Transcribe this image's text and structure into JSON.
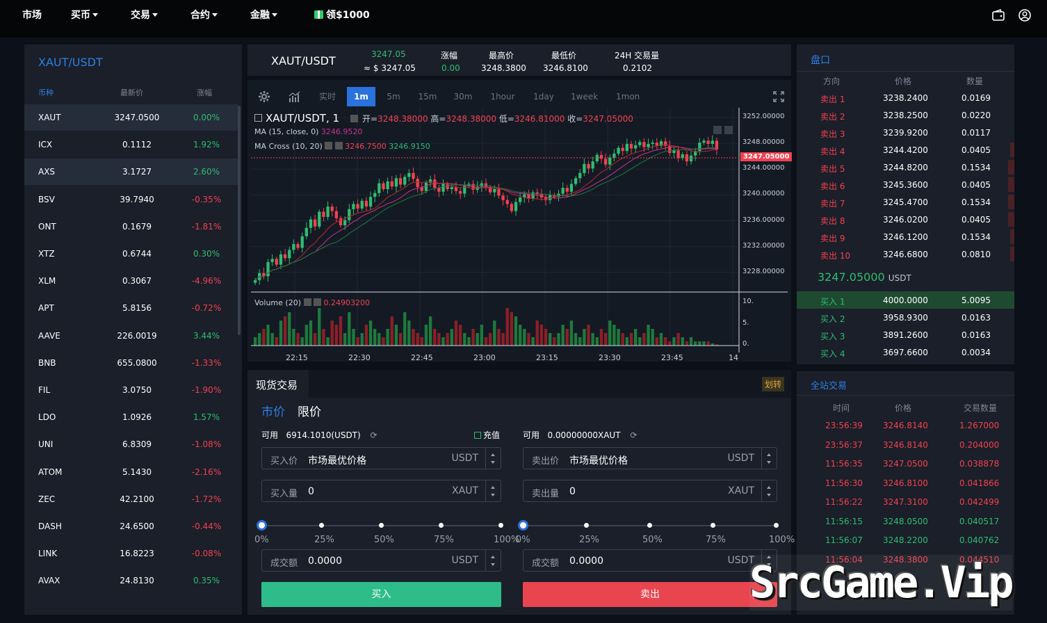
{
  "nav": {
    "market": "市场",
    "buy_coin": "买币",
    "trade": "交易",
    "contract": "合约",
    "finance": "金融",
    "promo": "领$1000",
    "wallet_icon": "wallet-icon",
    "user_icon": "user-icon"
  },
  "market_list": {
    "title": "XAUT/USDT",
    "col_coin": "币种",
    "col_price": "最新价",
    "col_change": "涨幅",
    "rows": [
      {
        "coin": "XAUT",
        "price": "3247.0500",
        "change": "0.00%",
        "dir": "up"
      },
      {
        "coin": "ICX",
        "price": "0.1112",
        "change": "1.92%",
        "dir": "up"
      },
      {
        "coin": "AXS",
        "price": "3.1727",
        "change": "2.60%",
        "dir": "up"
      },
      {
        "coin": "BSV",
        "price": "39.7940",
        "change": "-0.35%",
        "dir": "dn"
      },
      {
        "coin": "ONT",
        "price": "0.1679",
        "change": "-1.81%",
        "dir": "dn"
      },
      {
        "coin": "XTZ",
        "price": "0.6744",
        "change": "0.30%",
        "dir": "up"
      },
      {
        "coin": "XLM",
        "price": "0.3067",
        "change": "-4.96%",
        "dir": "dn"
      },
      {
        "coin": "APT",
        "price": "5.8156",
        "change": "-0.72%",
        "dir": "dn"
      },
      {
        "coin": "AAVE",
        "price": "226.0019",
        "change": "3.44%",
        "dir": "up"
      },
      {
        "coin": "BNB",
        "price": "655.0800",
        "change": "-1.33%",
        "dir": "dn"
      },
      {
        "coin": "FIL",
        "price": "3.0750",
        "change": "-1.90%",
        "dir": "dn"
      },
      {
        "coin": "LDO",
        "price": "1.0926",
        "change": "1.57%",
        "dir": "up"
      },
      {
        "coin": "UNI",
        "price": "6.8309",
        "change": "-1.08%",
        "dir": "dn"
      },
      {
        "coin": "ATOM",
        "price": "5.1430",
        "change": "-2.16%",
        "dir": "dn"
      },
      {
        "coin": "ZEC",
        "price": "42.2100",
        "change": "-1.72%",
        "dir": "dn"
      },
      {
        "coin": "DASH",
        "price": "24.6500",
        "change": "-0.44%",
        "dir": "dn"
      },
      {
        "coin": "LINK",
        "price": "16.8223",
        "change": "-0.08%",
        "dir": "dn"
      },
      {
        "coin": "AVAX",
        "price": "24.8130",
        "change": "0.35%",
        "dir": "up"
      }
    ]
  },
  "ticker": {
    "pair": "XAUT/USDT",
    "price": "3247.05",
    "price_usd": "≈ $ 3247.05",
    "change_label": "涨幅",
    "change": "0.00",
    "high_label": "最高价",
    "high": "3248.3800",
    "low_label": "最低价",
    "low": "3246.8100",
    "vol_label": "24H 交易量",
    "vol": "0.2102"
  },
  "chart_toolbar": {
    "settings_icon": "gear-icon",
    "indicator_icon": "chart-bars-icon",
    "realtime": "实时",
    "intervals": [
      "1m",
      "5m",
      "15m",
      "30m",
      "1hour",
      "1day",
      "1week",
      "1mon"
    ],
    "active": "1m",
    "fullscreen_icon": "expand-icon"
  },
  "chart_legend": {
    "symbol": "XAUT/USDT, 1",
    "open_label": "开=",
    "open": "3248.38000",
    "high_label": "高=",
    "high": "3248.38000",
    "low_label": "低=",
    "low": "3246.81000",
    "close_label": "收=",
    "close": "3247.05000",
    "ma": "MA (15, close, 0)",
    "ma_value": "3246.9520",
    "ma_cross": "MA Cross (10, 20)",
    "ma_cross_v1": "3246.7500",
    "ma_cross_v2": "3246.9150",
    "volume": "Volume (20)",
    "volume_value": "0.24903200",
    "current_price_tag": "3247.05000"
  },
  "chart_data": {
    "type": "candlestick",
    "y_ticks": [
      "3252.00000",
      "3248.00000",
      "3244.00000",
      "3240.00000",
      "3236.00000",
      "3232.00000",
      "3228.00000"
    ],
    "ylim": [
      3225.5,
      3253.5
    ],
    "x_ticks": [
      "22:15",
      "22:30",
      "22:45",
      "23:00",
      "23:15",
      "23:30",
      "23:45",
      "14"
    ],
    "volume_ticks": [
      "10.",
      "5.",
      "0."
    ],
    "last_price": 3247.05,
    "closes": [
      3226.8,
      3227.9,
      3227.4,
      3229.6,
      3230.1,
      3229.2,
      3230.8,
      3230.2,
      3231.5,
      3232.4,
      3231.8,
      3233.6,
      3234.9,
      3236.2,
      3235.1,
      3237.4,
      3236.6,
      3238.2,
      3237.5,
      3236.4,
      3235.3,
      3236.1,
      3237.8,
      3238.6,
      3237.9,
      3239.1,
      3238.2,
      3239.7,
      3240.3,
      3241.8,
      3240.9,
      3242.1,
      3241.3,
      3242.6,
      3241.6,
      3242.8,
      3243.4,
      3242.5,
      3241.2,
      3240.6,
      3241.9,
      3242.4,
      3241.1,
      3240.5,
      3241.7,
      3240.9,
      3241.2,
      3240.6,
      3240.2,
      3241.4,
      3241.7,
      3240.8,
      3241.3,
      3241.8,
      3241.2,
      3240.4,
      3240.9,
      3239.9,
      3239.2,
      3238.6,
      3237.5,
      3238.9,
      3239.6,
      3240.1,
      3239.4,
      3240.4,
      3240.1,
      3239.6,
      3239.2,
      3240.0,
      3239.7,
      3240.2,
      3241.1,
      3240.5,
      3241.7,
      3242.6,
      3243.4,
      3244.8,
      3244.1,
      3245.2,
      3246.2,
      3245.6,
      3244.7,
      3245.8,
      3246.4,
      3247.3,
      3246.8,
      3247.9,
      3247.2,
      3247.7,
      3248.2,
      3247.4,
      3247.9,
      3248.1,
      3247.6,
      3248.3,
      3247.6,
      3246.5,
      3246.9,
      3245.7,
      3246.3,
      3245.2,
      3246.1,
      3246.8,
      3248.1,
      3248.4,
      3247.9,
      3248.4,
      3247.05
    ],
    "volumes": [
      2,
      3,
      4,
      5,
      3,
      2,
      6,
      7,
      8,
      4,
      3,
      2,
      5,
      6,
      3,
      9,
      4,
      2,
      6,
      5,
      7,
      3,
      8,
      4,
      2,
      3,
      5,
      6,
      4,
      3,
      2,
      4,
      7,
      5,
      3,
      8,
      6,
      4,
      3,
      2,
      5,
      7,
      4,
      3,
      2,
      3,
      4,
      6,
      5,
      3,
      2,
      4,
      3,
      5,
      2,
      3,
      6,
      4,
      3,
      9,
      8,
      7,
      5,
      4,
      3,
      2,
      6,
      5,
      4,
      3,
      2,
      3,
      5,
      4,
      6,
      3,
      2,
      4,
      5,
      3,
      2,
      4,
      3,
      6,
      5,
      4,
      3,
      2,
      3,
      4,
      2,
      3,
      5,
      4,
      2,
      3,
      2,
      1,
      2,
      3,
      2,
      1,
      2,
      1,
      1,
      1,
      1,
      0.5,
      0.3
    ]
  },
  "orderbook": {
    "title": "盘口",
    "col_side": "方向",
    "col_price": "价格",
    "col_qty": "数量",
    "asks": [
      {
        "side": "卖出 1",
        "price": "3238.2400",
        "qty": "0.0169",
        "depth": 0
      },
      {
        "side": "卖出 2",
        "price": "3238.2500",
        "qty": "0.0220",
        "depth": 0
      },
      {
        "side": "卖出 3",
        "price": "3239.9200",
        "qty": "0.0117",
        "depth": 0
      },
      {
        "side": "卖出 4",
        "price": "3244.4200",
        "qty": "0.0405",
        "depth": 0.02
      },
      {
        "side": "卖出 5",
        "price": "3244.8200",
        "qty": "0.1534",
        "depth": 0.03
      },
      {
        "side": "卖出 6",
        "price": "3245.3600",
        "qty": "0.0405",
        "depth": 0.03
      },
      {
        "side": "卖出 7",
        "price": "3245.4700",
        "qty": "0.1534",
        "depth": 0.03
      },
      {
        "side": "卖出 8",
        "price": "3246.0200",
        "qty": "0.0405",
        "depth": 0.03
      },
      {
        "side": "卖出 9",
        "price": "3246.1200",
        "qty": "0.1534",
        "depth": 0.02
      },
      {
        "side": "卖出 10",
        "price": "3246.6800",
        "qty": "0.0810",
        "depth": 0.02
      }
    ],
    "last_price": "3247.05000",
    "last_unit": "USDT",
    "bids": [
      {
        "side": "买入 1",
        "price": "4000.0000",
        "qty": "5.0095"
      },
      {
        "side": "买入 2",
        "price": "3958.9300",
        "qty": "0.0163"
      },
      {
        "side": "买入 3",
        "price": "3891.2600",
        "qty": "0.0163"
      },
      {
        "side": "买入 4",
        "price": "3697.6600",
        "qty": "0.0034"
      }
    ]
  },
  "trades": {
    "title": "全站交易",
    "col_time": "时间",
    "col_price": "价格",
    "col_qty": "交易数量",
    "rows": [
      {
        "time": "23:56:39",
        "price": "3246.8140",
        "qty": "1.267000",
        "dir": "dn"
      },
      {
        "time": "23:56:37",
        "price": "3246.8140",
        "qty": "0.204000",
        "dir": "dn"
      },
      {
        "time": "11:56:35",
        "price": "3247.0500",
        "qty": "0.038878",
        "dir": "dn"
      },
      {
        "time": "11:56:30",
        "price": "3246.8100",
        "qty": "0.041866",
        "dir": "dn"
      },
      {
        "time": "11:56:22",
        "price": "3247.3100",
        "qty": "0.042499",
        "dir": "dn"
      },
      {
        "time": "11:56:15",
        "price": "3248.0500",
        "qty": "0.040517",
        "dir": "up"
      },
      {
        "time": "11:56:07",
        "price": "3248.2200",
        "qty": "0.040762",
        "dir": "up"
      },
      {
        "time": "11:56:04",
        "price": "3248.3800",
        "qty": "0.044510",
        "dir": "dn"
      }
    ]
  },
  "spot": {
    "title": "现货交易",
    "transfer": "划转",
    "tab_market": "市价",
    "tab_limit": "限价",
    "buy": {
      "avail_label": "可用",
      "avail": "6914.1010(USDT)",
      "deposit": "充值",
      "price_label": "买入价",
      "price_value": "市场最优价格",
      "price_unit": "USDT",
      "qty_label": "买入量",
      "qty_value": "0",
      "qty_unit": "XAUT",
      "total_label": "成交额",
      "total_value": "0.0000",
      "total_unit": "USDT",
      "button": "买入"
    },
    "sell": {
      "avail_label": "可用",
      "avail": "0.00000000XAUT",
      "price_label": "卖出价",
      "price_value": "市场最优价格",
      "price_unit": "USDT",
      "qty_label": "卖出量",
      "qty_value": "0",
      "qty_unit": "XAUT",
      "total_label": "成交额",
      "total_value": "0.0000",
      "total_unit": "USDT",
      "button": "卖出"
    },
    "percents": [
      "0%",
      "25%",
      "50%",
      "75%",
      "100%"
    ]
  },
  "watermark": "SrcGame.Vip",
  "colors": {
    "up": "#2ebd71",
    "down": "#f2414f",
    "accent": "#2a72dc",
    "buy_button": "#2ebd8a",
    "sell_button": "#e8454f"
  }
}
